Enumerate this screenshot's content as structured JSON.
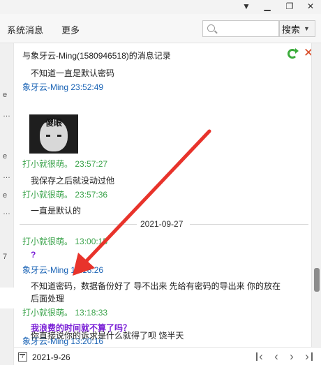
{
  "toolbar": {
    "system_messages": "系统消息",
    "more": "更多",
    "search_placeholder": "",
    "search_button": "搜索"
  },
  "left_strip": {
    "glyphs": [
      "e",
      "…",
      "e",
      "…",
      "e",
      "…",
      "7"
    ]
  },
  "history": {
    "title": "与象牙云-Ming(1580946518)的消息记录",
    "sticker_caption": "傻眼",
    "date_divider": "2021-09-27",
    "messages": [
      {
        "text": "不知道一直是默认密码"
      },
      {
        "sender": "象牙云-Ming",
        "time": "23:52:49"
      },
      {
        "sender": "打小就很萌。",
        "time": "23:57:27"
      },
      {
        "text": "我保存之后就没动过他"
      },
      {
        "sender": "打小就很萌。",
        "time": "23:57:36"
      },
      {
        "text": "一直是默认的"
      },
      {
        "sender": "打小就很萌。",
        "time": "13:00:15"
      },
      {
        "text": "?"
      },
      {
        "sender": "象牙云-Ming",
        "time": "13:18:26"
      },
      {
        "text": "不知道密码，数据备份好了  导不出来  先给有密码的导出来  你的放在"
      },
      {
        "text": "后面处理"
      },
      {
        "sender": "打小就很萌。",
        "time": "13:18:33"
      },
      {
        "text": "我浪费的时间就不算了吗？"
      },
      {
        "sender": "象牙云-Ming",
        "time": "13:20:16"
      },
      {
        "text": "你直接说你的诉求是什么就得了呗   饶半天"
      }
    ]
  },
  "footer": {
    "date": "2021-9-26",
    "calendar_day": "7"
  },
  "colors": {
    "sender_self": "#3aa34a",
    "sender_other": "#1a63b5",
    "emphasis": "#7a1fd6",
    "annotation": "#e8332b"
  }
}
